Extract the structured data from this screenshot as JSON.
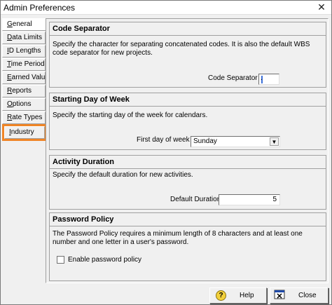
{
  "window": {
    "title": "Admin Preferences"
  },
  "nav": {
    "items": [
      {
        "label": "General",
        "u": "G",
        "rest": "eneral"
      },
      {
        "label": "Data Limits",
        "u": "D",
        "rest": "ata Limits"
      },
      {
        "label": "ID Lengths",
        "u": "I",
        "rest": "D Lengths"
      },
      {
        "label": "Time Periods",
        "u": "T",
        "rest": "ime Periods"
      },
      {
        "label": "Earned Value",
        "u": "E",
        "rest": "arned Value"
      },
      {
        "label": "Reports",
        "u": "R",
        "rest": "eports"
      },
      {
        "label": "Options",
        "u": "O",
        "rest": "ptions"
      },
      {
        "label": "Rate Types",
        "u": "R",
        "rest": "ate Types"
      },
      {
        "label": "Industry",
        "u": "I",
        "rest": "ndustry"
      }
    ],
    "active_index": 0,
    "highlight_color": "#f08526"
  },
  "code_separator": {
    "header": "Code Separator",
    "desc_line1": "Specify the character for separating concatenated codes.  It is also the default WBS",
    "desc_line2": "code separator for new projects.",
    "field_label": "Code Separator",
    "value": "."
  },
  "starting_day": {
    "header": "Starting Day of Week",
    "desc": "Specify the starting day of the week for calendars.",
    "field_label": "First day of week",
    "value": "Sunday"
  },
  "activity_duration": {
    "header": "Activity Duration",
    "desc": "Specify the default duration for new activities.",
    "field_label": "Default Duration",
    "value": "5"
  },
  "password_policy": {
    "header": "Password Policy",
    "desc_line1": "The Password Policy requires a minimum length of 8 characters and at least one",
    "desc_line2": "number and one letter in a user's password.",
    "checkbox_label": "Enable password policy",
    "checked": false
  },
  "buttons": {
    "help": "Help",
    "close": "Close"
  }
}
